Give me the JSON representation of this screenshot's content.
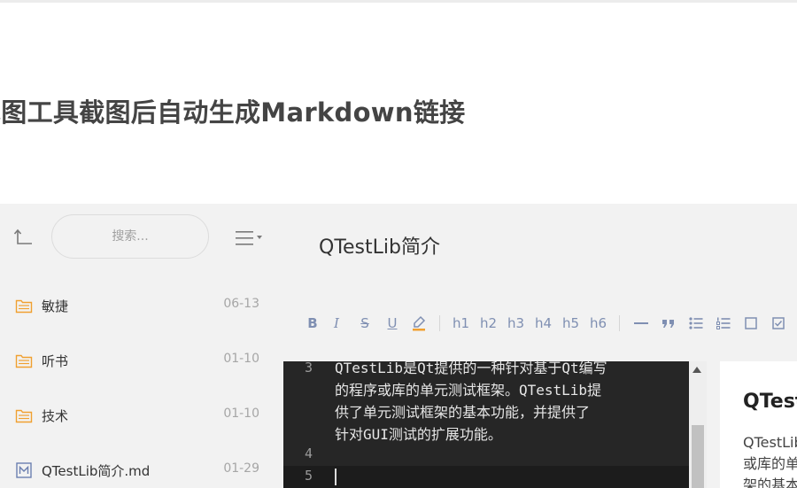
{
  "article": {
    "title": "截图工具截图后自动生成Markdown链接"
  },
  "sidebar": {
    "search": {
      "placeholder": "搜索..."
    },
    "items": [
      {
        "name": "敏捷",
        "date": "06-13",
        "icon": "folder-icon"
      },
      {
        "name": "听书",
        "date": "01-10",
        "icon": "folder-icon"
      },
      {
        "name": "技术",
        "date": "01-10",
        "icon": "folder-icon"
      },
      {
        "name": "QTestLib简介.md",
        "date": "01-29",
        "icon": "markdown-file-icon"
      }
    ]
  },
  "editor": {
    "doc_title": "QTestLib简介",
    "toolbar": {
      "bold": "B",
      "italic": "I",
      "strike": "S",
      "underline": "U",
      "h1": "h1",
      "h2": "h2",
      "h3": "h3",
      "h4": "h4",
      "h5": "h5",
      "h6": "h6"
    },
    "line_numbers": [
      "3",
      "4",
      "5"
    ],
    "code_lines": [
      "QTestLib是Qt提供的一种针对基于Qt编写",
      "的程序或库的单元测试框架。QTestLib提",
      "供了单元测试框架的基本功能，并提供了",
      "针对GUI测试的扩展功能。"
    ]
  },
  "preview": {
    "title": "QTestLib简介",
    "lines": [
      "QTestLib是Qt提供的",
      "或库的单元测试框",
      "架的基本功能"
    ]
  },
  "colors": {
    "toolbar_icon": "#7f8fb2",
    "folder_icon": "#f0a030",
    "editor_bg": "#262626",
    "sidebar_bg": "#f2f2f2"
  }
}
